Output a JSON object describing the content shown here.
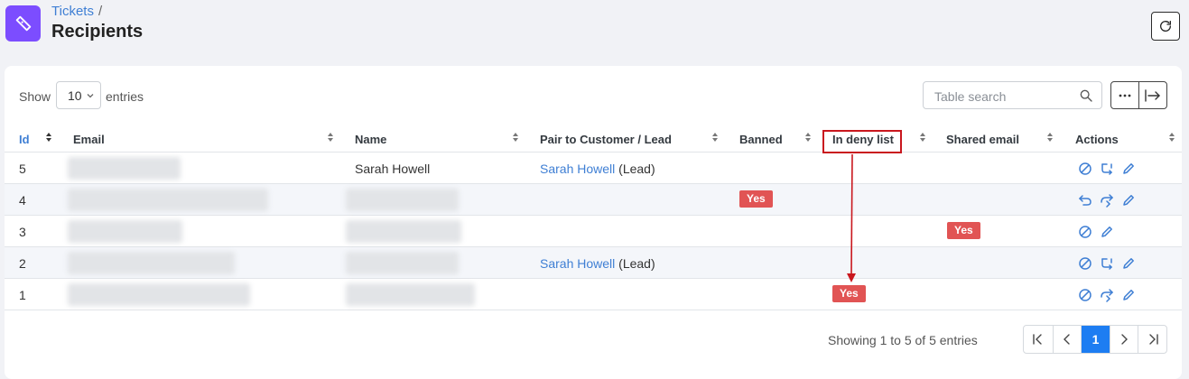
{
  "header": {
    "breadcrumb": "Tickets",
    "breadcrumb_sep": "/",
    "title": "Recipients",
    "app_icon": "ticket-icon",
    "refresh_icon": "refresh-icon"
  },
  "toolbar": {
    "show_label": "Show",
    "page_length": "10",
    "entries_label": "entries",
    "search_placeholder": "Table search"
  },
  "columns": [
    "Id",
    "Email",
    "Name",
    "Pair to Customer / Lead",
    "Banned",
    "In deny list",
    "Shared email",
    "Actions"
  ],
  "rows": [
    {
      "id": "5",
      "name": "Sarah Howell",
      "pair_name": "Sarah Howell",
      "pair_type": "(Lead)",
      "banned": "",
      "deny": "",
      "shared": "",
      "actions": [
        "ban-icon",
        "merge-icon",
        "edit-icon"
      ]
    },
    {
      "id": "4",
      "name": "",
      "pair_name": "",
      "pair_type": "",
      "banned": "Yes",
      "deny": "",
      "shared": "",
      "actions": [
        "undo-icon",
        "forward-icon",
        "edit-icon"
      ]
    },
    {
      "id": "3",
      "name": "",
      "pair_name": "",
      "pair_type": "",
      "banned": "",
      "deny": "",
      "shared": "Yes",
      "actions": [
        "ban-icon",
        "edit-icon"
      ]
    },
    {
      "id": "2",
      "name": "",
      "pair_name": "Sarah Howell",
      "pair_type": "(Lead)",
      "banned": "",
      "deny": "",
      "shared": "",
      "actions": [
        "ban-icon",
        "merge-icon",
        "edit-icon"
      ]
    },
    {
      "id": "1",
      "name": "",
      "pair_name": "",
      "pair_type": "",
      "banned": "",
      "deny": "Yes",
      "shared": "",
      "actions": [
        "ban-icon",
        "forward-icon",
        "edit-icon"
      ]
    }
  ],
  "footer": {
    "info": "Showing 1 to 5 of 5 entries",
    "current_page": "1"
  },
  "colors": {
    "accent": "#3f7fd4",
    "badge": "#e15454",
    "app_icon_bg": "#7c4dff",
    "highlight": "#c9171e"
  }
}
